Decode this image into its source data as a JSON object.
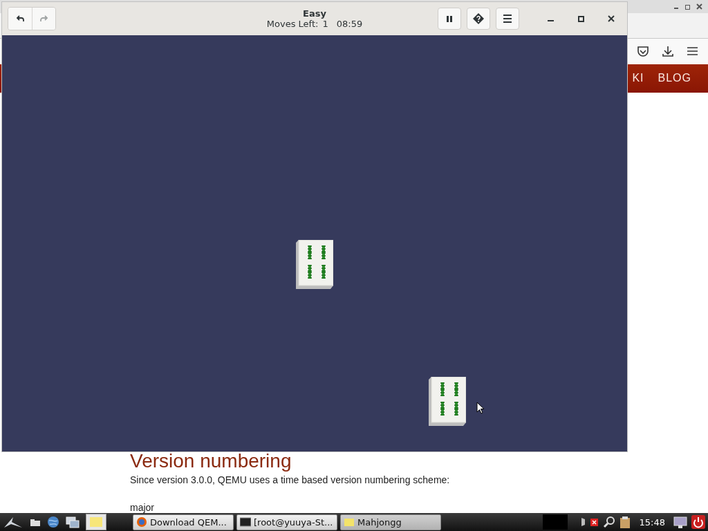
{
  "browser": {
    "nav_items": [
      "KI",
      "BLOG"
    ],
    "heading": "Version numbering",
    "paragraph": "Since version 3.0.0, QEMU uses a time based version numbering scheme:",
    "list_item": "major"
  },
  "mahjongg": {
    "title": "Easy",
    "moves_label": "Moves Left:",
    "moves": "1",
    "time": "08:59",
    "redo_disabled": true,
    "tiles": [
      {
        "kind": "bamboo",
        "selected": false
      },
      {
        "kind": "bamboo",
        "selected": false
      }
    ]
  },
  "taskbar": {
    "tasks": [
      {
        "label": "Download QEM...",
        "kind": "browser",
        "selected": false
      },
      {
        "label": "[root@yuuya-St...",
        "kind": "terminal",
        "selected": false
      },
      {
        "label": "Mahjongg",
        "kind": "game",
        "selected": true
      }
    ],
    "clock": "15:48"
  }
}
